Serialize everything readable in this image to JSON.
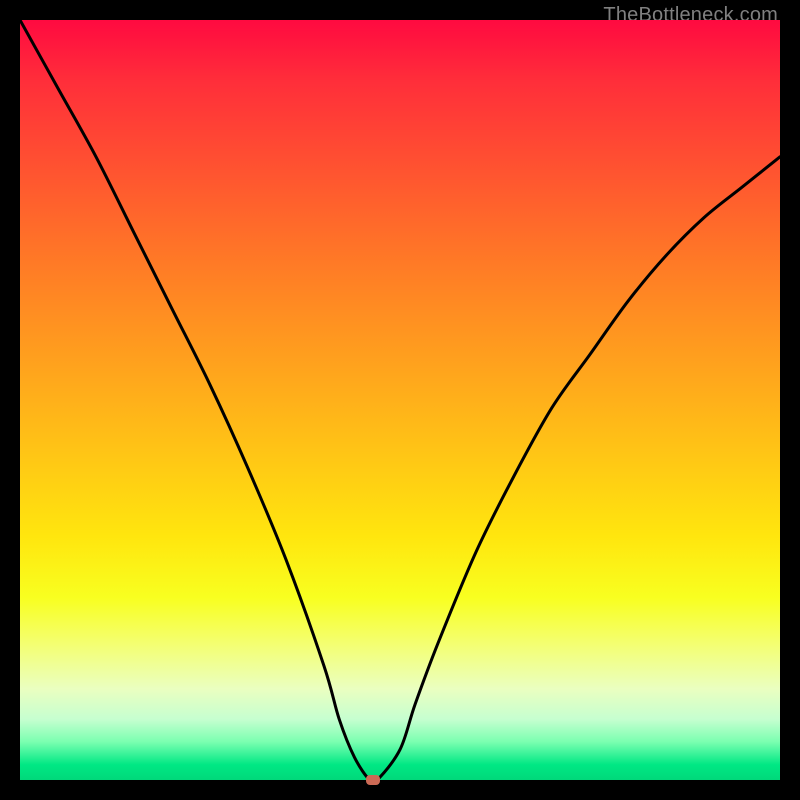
{
  "watermark": "TheBottleneck.com",
  "colors": {
    "frame": "#000000",
    "curve": "#000000",
    "marker": "#cc6a55",
    "gradient_top": "#ff0a40",
    "gradient_bottom": "#00d87a"
  },
  "chart_data": {
    "type": "line",
    "title": "",
    "xlabel": "",
    "ylabel": "",
    "xlim": [
      0,
      100
    ],
    "ylim": [
      0,
      100
    ],
    "grid": false,
    "legend": false,
    "series": [
      {
        "name": "bottleneck-curve",
        "x": [
          0,
          5,
          10,
          15,
          20,
          25,
          30,
          35,
          40,
          42,
          44,
          46,
          47,
          50,
          52,
          55,
          60,
          65,
          70,
          75,
          80,
          85,
          90,
          95,
          100
        ],
        "values": [
          100,
          91,
          82,
          72,
          62,
          52,
          41,
          29,
          15,
          8,
          3,
          0,
          0,
          4,
          10,
          18,
          30,
          40,
          49,
          56,
          63,
          69,
          74,
          78,
          82
        ]
      }
    ],
    "marker": {
      "x": 46.5,
      "y": 0
    },
    "annotations": []
  }
}
